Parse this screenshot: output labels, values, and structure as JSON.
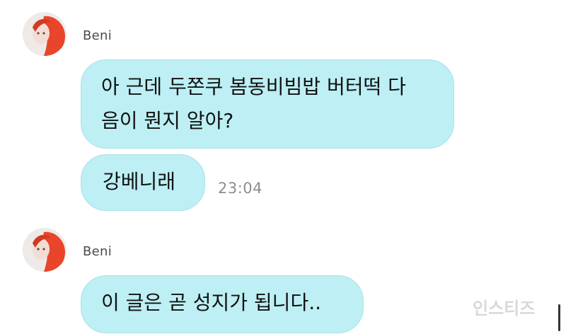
{
  "messages": [
    {
      "sender": "Beni",
      "bubbles": [
        {
          "text": "아 근데 두쫀쿠 봄동비빔밥 버터떡 다\n음이 뭔지 알아?"
        },
        {
          "text": "강베니래",
          "time": "23:04"
        }
      ]
    },
    {
      "sender": "Beni",
      "bubbles": [
        {
          "text": "이 글은 곧 성지가 됩니다.."
        }
      ]
    }
  ],
  "watermark": "인스티즈",
  "colors": {
    "bubble": "#bdeff4",
    "bubble_border": "#a9e3ea",
    "timestamp": "#8e8e8e",
    "avatar_accent": "#e8452a"
  }
}
